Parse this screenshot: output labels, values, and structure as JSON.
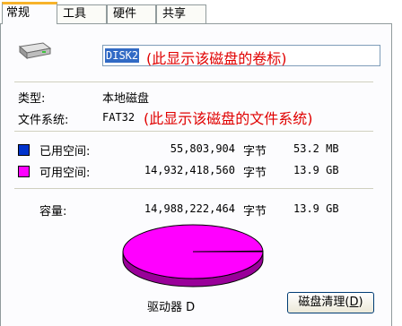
{
  "tabs": [
    "常规",
    "工具",
    "硬件",
    "共享"
  ],
  "volume_label": {
    "value": "DISK2",
    "annotation": "(此显示该磁盘的卷标)"
  },
  "type": {
    "label": "类型:",
    "value": "本地磁盘"
  },
  "file_system": {
    "label": "文件系统:",
    "value": "FAT32",
    "annotation": "(此显示该磁盘的文件系统)"
  },
  "used_space": {
    "label": "已用空间:",
    "bytes": "55,803,904",
    "unit": "字节",
    "size": "53.2 MB",
    "color": "#0033cc"
  },
  "free_space": {
    "label": "可用空间:",
    "bytes": "14,932,418,560",
    "unit": "字节",
    "size": "13.9 GB",
    "color": "#ff00ff"
  },
  "capacity": {
    "label": "容量:",
    "bytes": "14,988,222,464",
    "unit": "字节",
    "size": "13.9 GB"
  },
  "drive_label": "驱动器 D",
  "cleanup_button": {
    "text": "磁盘清理(",
    "hotkey": "D",
    "suffix": ")"
  },
  "pie": {
    "used_fraction": 0.0037,
    "free_color": "#ff00ff",
    "used_color": "#0033cc"
  },
  "icons": {
    "drive": "hard-disk-icon"
  }
}
